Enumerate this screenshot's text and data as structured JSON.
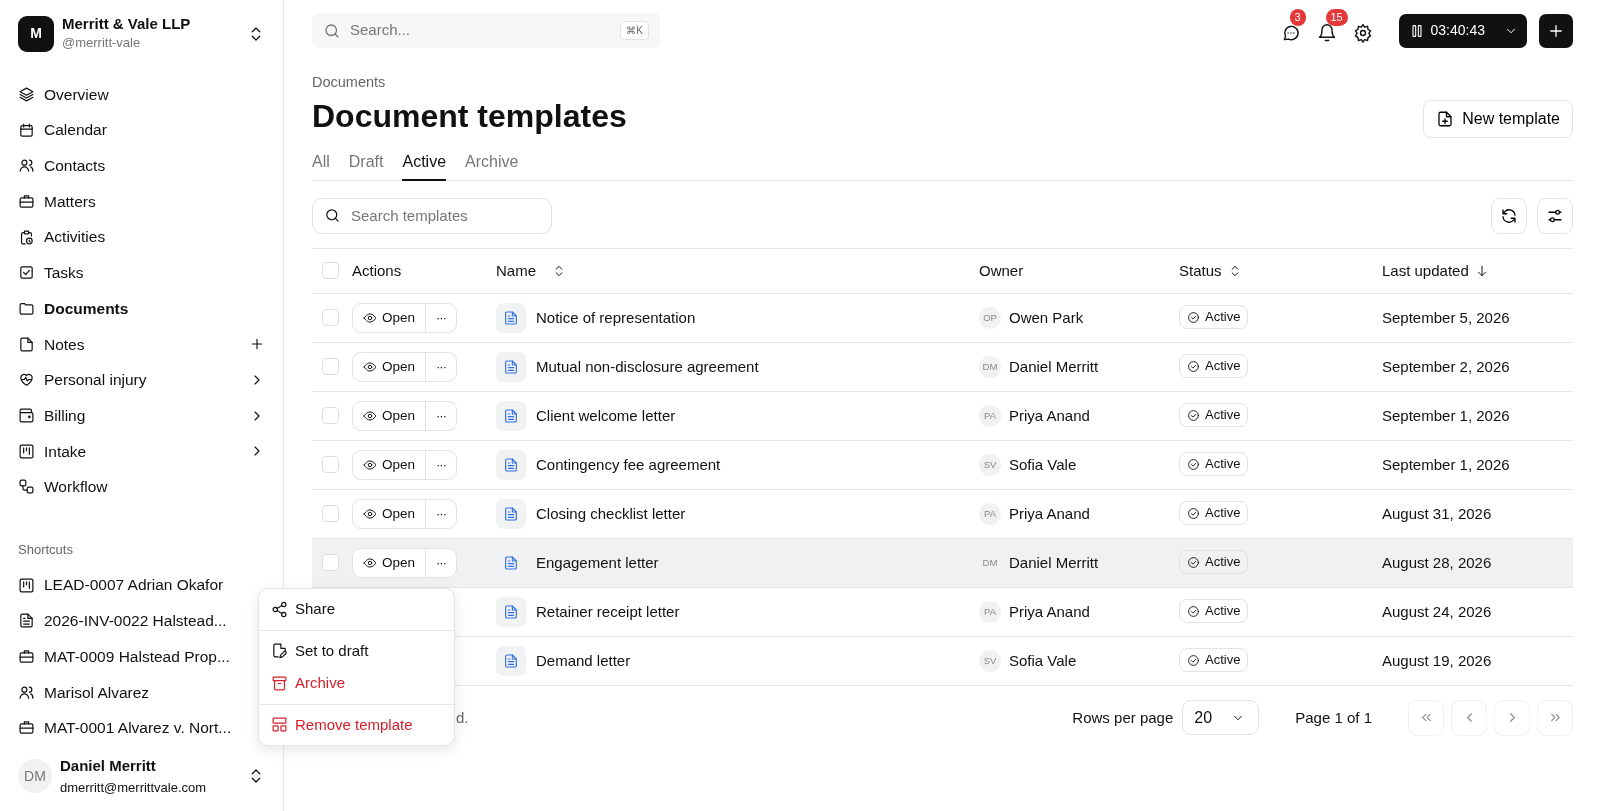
{
  "workspace": {
    "initial": "M",
    "name": "Merritt & Vale LLP",
    "handle": "@merritt-vale"
  },
  "nav": [
    {
      "label": "Overview",
      "selected": false,
      "kind": "plain"
    },
    {
      "label": "Calendar",
      "selected": false,
      "kind": "plain"
    },
    {
      "label": "Contacts",
      "selected": false,
      "kind": "plain"
    },
    {
      "label": "Matters",
      "selected": false,
      "kind": "plain"
    },
    {
      "label": "Activities",
      "selected": false,
      "kind": "plain"
    },
    {
      "label": "Tasks",
      "selected": false,
      "kind": "plain"
    },
    {
      "label": "Documents",
      "selected": true,
      "kind": "plain"
    },
    {
      "label": "Notes",
      "selected": false,
      "kind": "add"
    },
    {
      "label": "Personal injury",
      "selected": false,
      "kind": "expand"
    },
    {
      "label": "Billing",
      "selected": false,
      "kind": "expand"
    },
    {
      "label": "Intake",
      "selected": false,
      "kind": "expand"
    },
    {
      "label": "Workflow",
      "selected": false,
      "kind": "plain"
    }
  ],
  "shortcuts": {
    "title": "Shortcuts",
    "items": [
      "LEAD-0007 Adrian Okafor",
      "2026-INV-0022 Halstead...",
      "MAT-0009 Halstead Prop...",
      "Marisol Alvarez",
      "MAT-0001 Alvarez v. Nort..."
    ]
  },
  "user": {
    "initials": "DM",
    "name": "Daniel Merritt",
    "email": "dmerritt@merrittvale.com"
  },
  "topbar": {
    "search": {
      "placeholder": "Search...",
      "shortcut": "⌘K"
    },
    "messages_badge": "3",
    "notifications_badge": "15",
    "timer": "03:40:43"
  },
  "breadcrumb": "Documents",
  "title": "Document templates",
  "new_button": "New template",
  "tabs": [
    {
      "label": "All",
      "selected": false
    },
    {
      "label": "Draft",
      "selected": false
    },
    {
      "label": "Active",
      "selected": true
    },
    {
      "label": "Archive",
      "selected": false
    }
  ],
  "filter": {
    "placeholder": "Search templates"
  },
  "table": {
    "select_all_checked": false,
    "columns": [
      {
        "label": "Actions",
        "sortable": false
      },
      {
        "label": "Name",
        "sortable": true,
        "descending": false
      },
      {
        "label": "Owner",
        "sortable": false
      },
      {
        "label": "Status",
        "sortable": true,
        "descending": false
      },
      {
        "label": "Last updated",
        "sortable": true,
        "descending": true
      }
    ],
    "rows": [
      {
        "checked": false,
        "highlighted": false,
        "open": "Open",
        "more": "···",
        "name": "Notice of representation",
        "owner_initials": "OP",
        "owner": "Owen Park",
        "status": "Active",
        "updated": "September 5, 2026"
      },
      {
        "checked": false,
        "highlighted": false,
        "open": "Open",
        "more": "···",
        "name": "Mutual non-disclosure agreement",
        "owner_initials": "DM",
        "owner": "Daniel Merritt",
        "status": "Active",
        "updated": "September 2, 2026"
      },
      {
        "checked": false,
        "highlighted": false,
        "open": "Open",
        "more": "···",
        "name": "Client welcome letter",
        "owner_initials": "PA",
        "owner": "Priya Anand",
        "status": "Active",
        "updated": "September 1, 2026"
      },
      {
        "checked": false,
        "highlighted": false,
        "open": "Open",
        "more": "···",
        "name": "Contingency fee agreement",
        "owner_initials": "SV",
        "owner": "Sofia Vale",
        "status": "Active",
        "updated": "September 1, 2026"
      },
      {
        "checked": false,
        "highlighted": false,
        "open": "Open",
        "more": "···",
        "name": "Closing checklist letter",
        "owner_initials": "PA",
        "owner": "Priya Anand",
        "status": "Active",
        "updated": "August 31, 2026"
      },
      {
        "checked": false,
        "highlighted": true,
        "open": "Open",
        "more": "···",
        "name": "Engagement letter",
        "owner_initials": "DM",
        "owner": "Daniel Merritt",
        "status": "Active",
        "updated": "August 28, 2026"
      },
      {
        "name": "Retainer receipt letter",
        "highlighted": false,
        "owner_initials": "PA",
        "owner": "Priya Anand",
        "status": "Active",
        "updated": "August 24, 2026"
      },
      {
        "name": "Demand letter",
        "highlighted": false,
        "owner_initials": "SV",
        "owner": "Sofia Vale",
        "status": "Active",
        "updated": "August 19, 2026"
      }
    ]
  },
  "footer": {
    "selection_text": "d.",
    "rows_label": "Rows per page",
    "rows_value": "20",
    "page": "Page 1 of 1"
  },
  "menu": {
    "groups": [
      [
        {
          "label": "Share",
          "danger": false
        }
      ],
      [
        {
          "label": "Set to draft",
          "danger": false
        },
        {
          "label": "Archive",
          "danger": true
        }
      ],
      [
        {
          "label": "Remove template",
          "danger": true
        }
      ]
    ]
  }
}
